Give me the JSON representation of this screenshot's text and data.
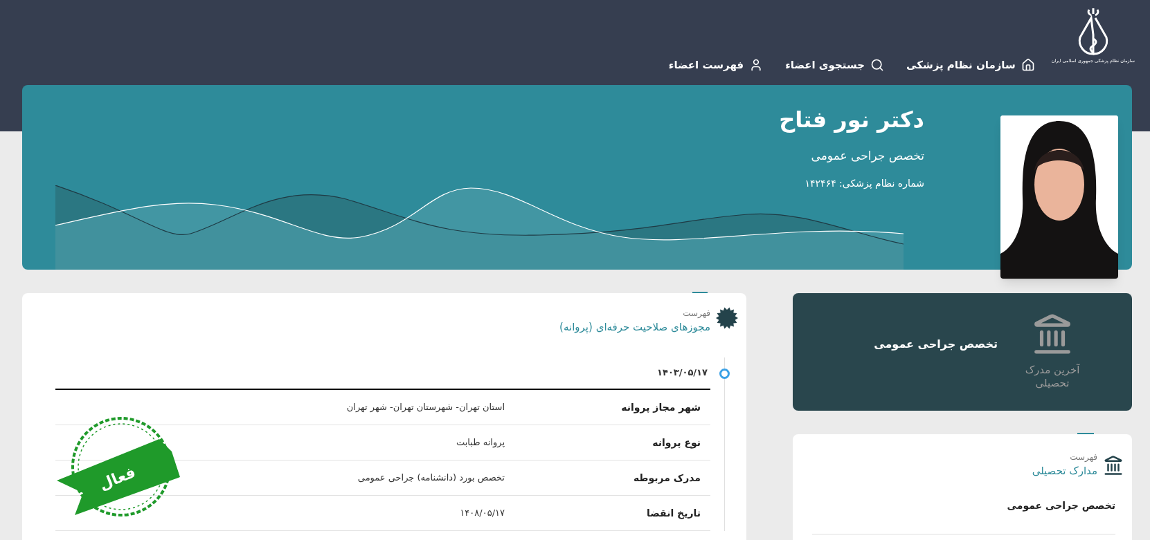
{
  "header": {
    "logo_caption": "سازمان نظام پزشکی جمهوری اسلامی ایران",
    "nav": [
      {
        "kind": "home",
        "label": "سازمان نظام پزشکی"
      },
      {
        "kind": "search",
        "label": "جستجوی اعضاء"
      },
      {
        "kind": "members",
        "label": "فهرست اعضاء"
      }
    ]
  },
  "profile": {
    "name": "دکتر نور فتاح",
    "specialty": "تخصص جراحی عمومی",
    "license_number": "شماره نظام پزشکی: ۱۴۲۴۶۴"
  },
  "latest_degree": {
    "label": "آخرین مدرک تحصیلی",
    "value": "تخصص جراحی عمومی"
  },
  "licenses": {
    "caption": "فهرست",
    "title": "مجوزهای صلاحیت حرفه‌ای (پروانه)",
    "entries": [
      {
        "date": "۱۴۰۳/۰۵/۱۷",
        "stamp": {
          "label": "فعال",
          "active": true
        },
        "rows": [
          {
            "label": "شهر مجاز پروانه",
            "value": "استان تهران- شهرستان تهران- شهر تهران"
          },
          {
            "label": "نوع پروانه",
            "value": "پروانه طبابت"
          },
          {
            "label": "مدرک مربوطه",
            "value": "تخصص بورد (دانشنامه) جراحی عمومی"
          },
          {
            "label": "تاریخ انقضا",
            "value": "۱۴۰۸/۰۵/۱۷"
          }
        ]
      }
    ]
  },
  "degrees": {
    "caption": "فهرست",
    "title": "مدارک تحصیلی",
    "items": [
      "تخصص جراحی عمومی"
    ]
  }
}
